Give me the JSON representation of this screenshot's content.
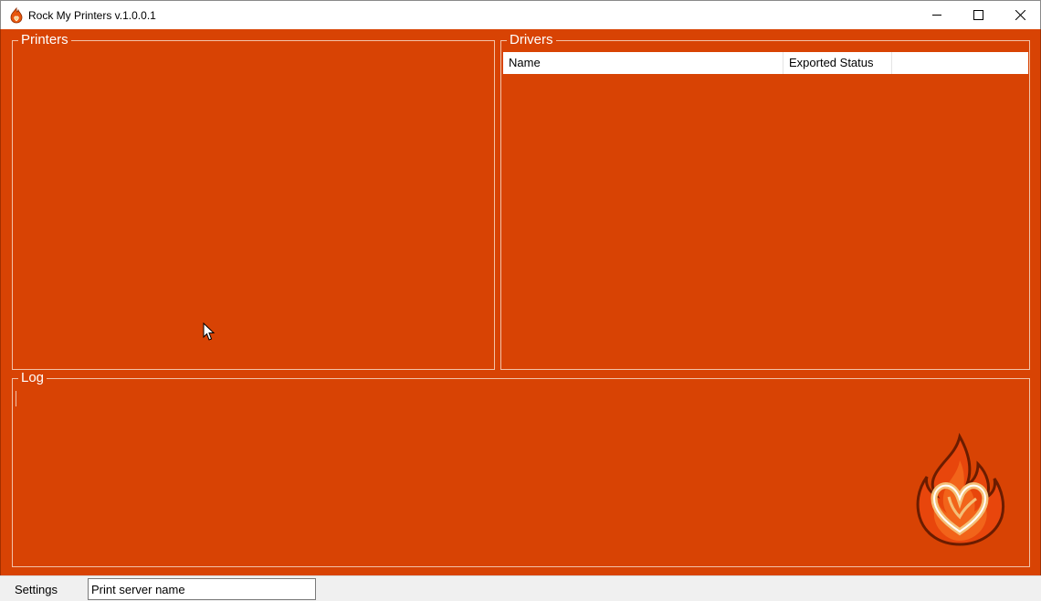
{
  "window": {
    "title": "Rock My Printers v.1.0.0.1",
    "app_icon": "flame-icon",
    "controls": [
      "minimize-icon",
      "maximize-icon",
      "close-icon"
    ]
  },
  "printers": {
    "title": "Printers",
    "items": []
  },
  "drivers": {
    "title": "Drivers",
    "columns": [
      "Name",
      "Exported Status",
      ""
    ],
    "rows": []
  },
  "log": {
    "title": "Log",
    "text": "",
    "logo": "flame-heart-logo"
  },
  "statusbar": {
    "settings_label": "Settings",
    "server_input_value": "Print server name"
  },
  "colors": {
    "background": "#d84304",
    "group_border": "#f2c2a8",
    "titlebar": "#ffffff",
    "statusbar": "#f0f0f0"
  }
}
